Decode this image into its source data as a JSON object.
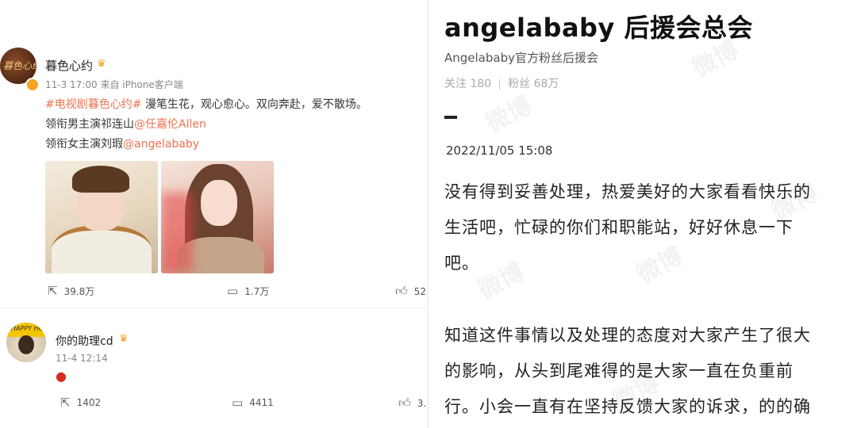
{
  "post": {
    "avatar_text": "暮色心约",
    "user_name": "暮色心约",
    "meta": "11-3 17:00  来自 iPhone客户端",
    "hashtag": "#电视剧暮色心约#",
    "line1_rest": " 漫笔生花，观心愈心。双向奔赴，爱不散场。",
    "line2_prefix": "领衔男主演祁连山",
    "line2_mention": "@任嘉伦Allen",
    "line3_prefix": "领衔女主演刘瑕",
    "line3_mention": "@angelababy",
    "repost_count": "39.8万",
    "comment_count": "1.7万",
    "like_count": "52"
  },
  "comment": {
    "avatar_text": "HAPPY HOLIDAY",
    "user_name": "你的助理cd",
    "meta": "11-4 12:14",
    "repost_count": "1402",
    "comment_count": "4411",
    "like_count": "3."
  },
  "right": {
    "title": "angelababy 后援会总会",
    "subtitle": "Angelababy官方粉丝后援会",
    "follow_label": "关注 180",
    "fans_label": "粉丝 68万",
    "date": "2022/11/05 15:08",
    "lines": [
      "没有得到妥善处理，热爱美好的大家看看快乐的",
      "生活吧，忙碌的你们和职能站，好好休息一下",
      "吧。",
      "知道这件事情以及处理的态度对大家产生了很大",
      "的影响，从头到尾难得的是大家一直在负重前",
      "行。小会一直有在坚持反馈大家的诉求，的的确"
    ],
    "watermark": "微博"
  },
  "icons": {
    "repost": "share-icon",
    "comment": "comment-icon",
    "like": "thumbs-up-icon",
    "crown": "crown-badge-icon",
    "verified": "verified-badge-icon",
    "apple": "apple-emoji-icon"
  },
  "colors": {
    "link": "#eb7350",
    "verified": "#f6a623"
  }
}
